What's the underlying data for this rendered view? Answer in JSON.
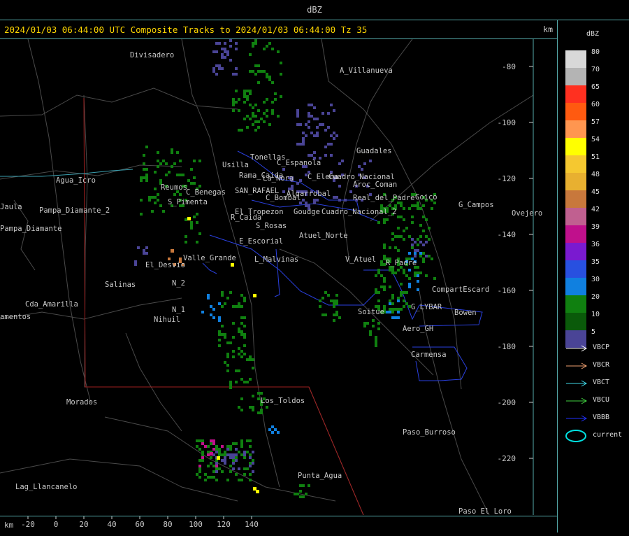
{
  "window": {
    "title": "dBZ"
  },
  "header": {
    "text": "2024/01/03 06:44:00 UTC Composite Tracks to 2024/01/03 06:44:00 Tz 35",
    "unit": "km"
  },
  "x_axis": {
    "unit": "km",
    "ticks": [
      "-20",
      "0",
      "20",
      "40",
      "60",
      "80",
      "100",
      "120",
      "140"
    ]
  },
  "y_axis": {
    "ticks": [
      "-80",
      "-100",
      "-120",
      "-140",
      "-160",
      "-180",
      "-200",
      "-220"
    ]
  },
  "places": [
    "Divisadero",
    "A_Villanueva",
    "Guadales",
    "Usilla",
    "Tonellas",
    "C_Espanola",
    "La_Nora",
    "C_Elena",
    "Cuadro_Nacional",
    "Aroc_Coman",
    "Rama_Caida",
    "C_Benegas",
    "SAN_RAFAEL",
    "Algarrobal",
    "Goudge",
    "C_Bombal",
    "El_Tropezon",
    "Cuadro_Nacional_2",
    "Real_del_Padre",
    "Pampa_Diamante",
    "Agua_Icro",
    "S_Pimenta",
    "R_Caida",
    "S_Rosas",
    "Atuel_Norte",
    "E_Escorial",
    "L_Malvinas",
    "Valle_Grande",
    "El_Desvio",
    "Salinas",
    "N_2",
    "N_1",
    "Nihuil",
    "Cda_Amarilla",
    "amentos",
    "Goico",
    "G_Campos",
    "Ovejero",
    "V_Atuel",
    "R_Padre",
    "CompartEscard",
    "G_LYBAR",
    "Soitue",
    "Bowen",
    "Aero_GH",
    "Carmensa",
    "Morados",
    "Los_Toldos",
    "Paso_Burroso",
    "Punta_Agua",
    "Lag_Llancanelo",
    "Paso_El_Loro",
    "Pampa_Diamante_2",
    "Reumos",
    "Jaula"
  ],
  "legend": {
    "title": "dBZ",
    "levels": [
      {
        "label": "80",
        "color": "#d8d8d8"
      },
      {
        "label": "70",
        "color": "#b4b4b4"
      },
      {
        "label": "65",
        "color": "#ff3020"
      },
      {
        "label": "60",
        "color": "#ff5a10"
      },
      {
        "label": "57",
        "color": "#ff9650"
      },
      {
        "label": "54",
        "color": "#ffff00"
      },
      {
        "label": "51",
        "color": "#f5c830"
      },
      {
        "label": "48",
        "color": "#e8b030"
      },
      {
        "label": "45",
        "color": "#c8783c"
      },
      {
        "label": "42",
        "color": "#c06090"
      },
      {
        "label": "39",
        "color": "#c0108c"
      },
      {
        "label": "36",
        "color": "#7a1ad0"
      },
      {
        "label": "35",
        "color": "#2850e0"
      },
      {
        "label": "30",
        "color": "#1080e0"
      },
      {
        "label": "20",
        "color": "#108010"
      },
      {
        "label": "10",
        "color": "#0a5a0a"
      },
      {
        "label": "5",
        "color": "#4a4496"
      }
    ],
    "tracks": [
      {
        "label": "VBCP",
        "color": "#ffffff"
      },
      {
        "label": "VBCR",
        "color": "#f0a070"
      },
      {
        "label": "VBCT",
        "color": "#40d8e8"
      },
      {
        "label": "VBCU",
        "color": "#40d040"
      },
      {
        "label": "VBBB",
        "color": "#2030ff"
      }
    ],
    "current_label": "current",
    "current_color": "#00e0e0"
  }
}
